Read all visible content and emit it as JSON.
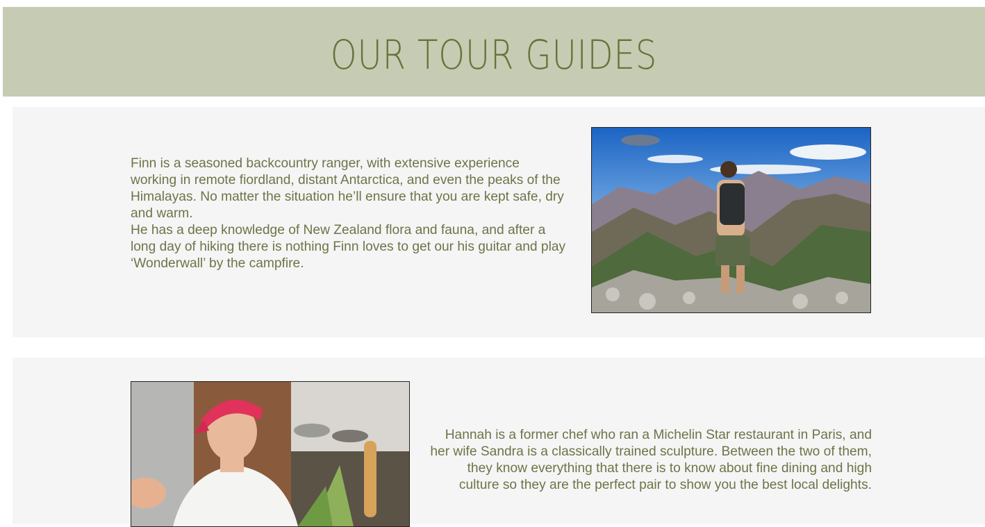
{
  "header": {
    "title": "OUR TOUR GUIDES"
  },
  "guides": [
    {
      "name": "Finn",
      "paragraphs": [
        "Finn is a seasoned backcountry ranger, with extensive experience working in remote fiordland, distant Antarctica, and even the peaks of the Himalayas. No matter the situation he’ll ensure that you are kept safe, dry and warm.",
        "He has a deep knowledge of New Zealand flora and fauna, and after a long day of hiking there is nothing Finn loves to get our his guitar and play ‘Wonderwall’ by the campfire."
      ],
      "photo": "hiker-on-mountain-photo"
    },
    {
      "name": "Hannah",
      "paragraphs": [
        "Hannah is a former chef who ran a Michelin Star restaurant in Paris, and her wife Sandra is a classically trained sculpture. Between the two of them, they know everything that there is to know about fine dining and high culture so they are the perfect pair to show you the best local delights."
      ],
      "photo": "chef-in-kitchen-photo"
    }
  ],
  "colors": {
    "header_bg": "#c6cbb3",
    "accent_text": "#68723a",
    "body_text": "#6b7548",
    "card_bg": "#f5f5f5"
  }
}
